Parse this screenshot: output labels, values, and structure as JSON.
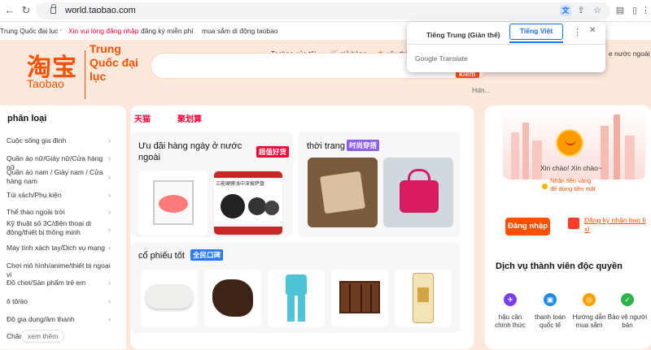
{
  "browser": {
    "url": "world.taobao.com",
    "translate_popup": {
      "tab_source": "Tiếng Trung (Giản thể)",
      "tab_target": "Tiếng Việt",
      "brand": "Google Translate"
    }
  },
  "site_top": {
    "region": "Trung Quốc đại lục",
    "login_prompt": "Xin vui lòng đăng nhập",
    "register": "đăng ký miễn phí",
    "mobile": "mua sắm di động taobao"
  },
  "header": {
    "logo_cn": "淘宝",
    "logo_en": "Taobao",
    "logo_side": "Trung Quốc đại lục",
    "my_taobao": "Taobao của tôi",
    "cart": "giỏ hàng",
    "favorites": "yêu thí",
    "partial_right": "c",
    "partial_right2": "e nước ngoài",
    "search_btn": "kiếm",
    "hdn": "Hdn..."
  },
  "categories": {
    "title": "phân loại",
    "items": [
      "Cuộc sống gia đình",
      "Quần áo nữ/Giày nữ/Cửa hàng nữ",
      "Quần áo nam / Giày nam / Cửa hàng nam",
      "Túi xách/Phụ kiện",
      "Thể thao ngoài trời",
      "Kỹ thuật số 3C/điện thoại di động/thiết bị thông minh",
      "Máy tính xách tay/Dịch vụ mạng",
      "Chơi mô hình/anime/thiết bị ngoại vi",
      "Đồ chơi/Sản phẩm trẻ em",
      "ô tô/áo",
      "Đồ gia dụng/âm thanh",
      "Chăm"
    ],
    "see_more": "xem thêm"
  },
  "center": {
    "brand_tabs": [
      "天猫",
      "聚划算"
    ],
    "daily_deals": {
      "title": "Ưu đãi hàng ngày ở nước ngoài",
      "badge": "超值好货"
    },
    "fashion": {
      "title": "thời trang",
      "badge": "时尚穿搭"
    },
    "good_stock": {
      "title": "cổ phiếu tốt",
      "badge": "全民口碑"
    },
    "product_tag": "三能硬膜浅中深披萨盘"
  },
  "right": {
    "greeting": "Xin chào! Xin chào~",
    "gold1": "Nhận tiền vàng",
    "gold2": "để dùng tiền mặt",
    "login": "Đăng nhập",
    "register_gift": "Đăng ký nhận bao lì xì",
    "services_title": "Dịch vụ thành viên độc quyền",
    "services": [
      {
        "label": "hậu cần chính thức",
        "icon": "plane-icon",
        "color": "#7b3ff2"
      },
      {
        "label": "thanh toán quốc tế",
        "icon": "wallet-icon",
        "color": "#1e88e5"
      },
      {
        "label": "Hướng dẫn mua sắm",
        "icon": "compass-icon",
        "color": "#ffa000"
      },
      {
        "label": "Bảo vệ người bán",
        "icon": "shield-icon",
        "color": "#2db34a"
      }
    ]
  }
}
